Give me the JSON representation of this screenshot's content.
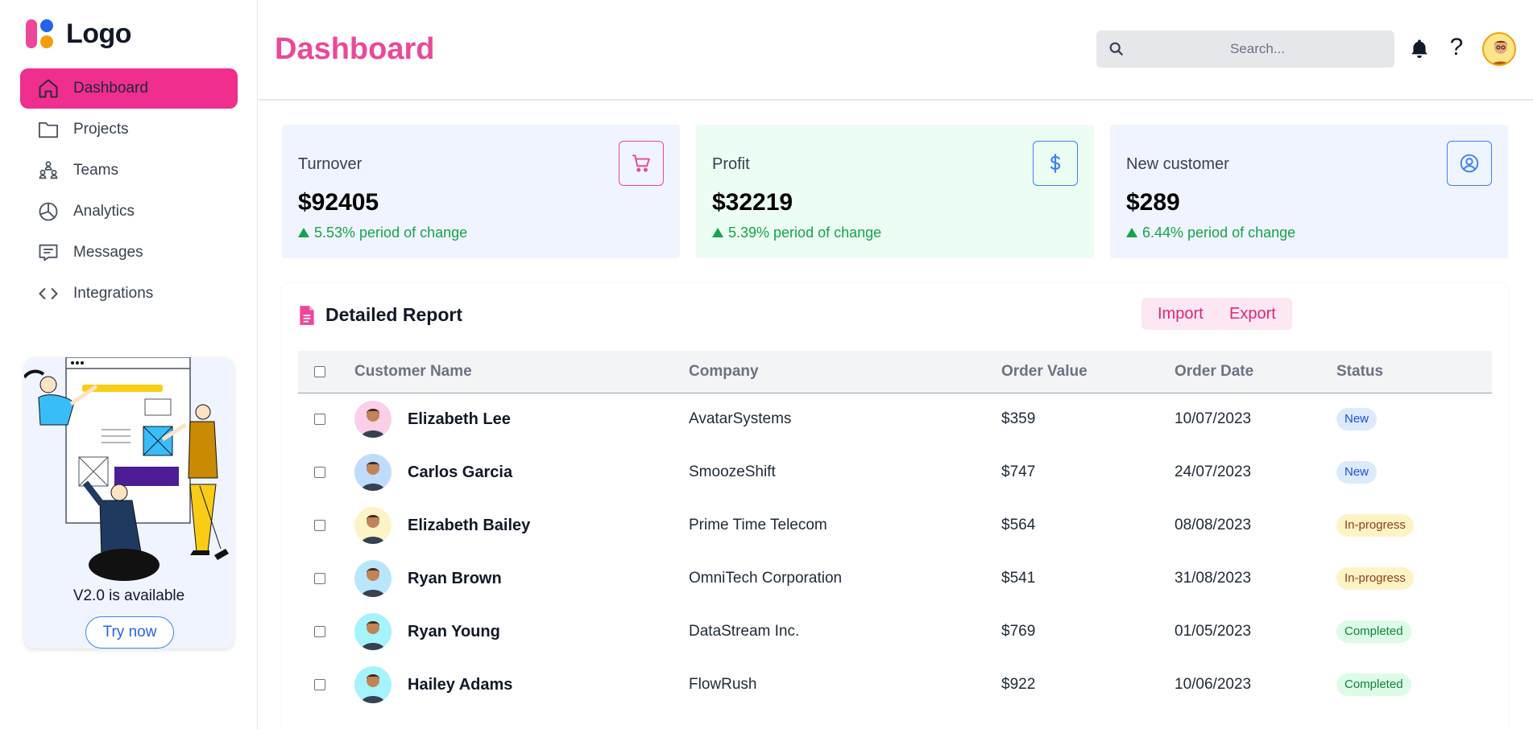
{
  "logo": {
    "text": "Logo"
  },
  "nav": {
    "items": [
      {
        "label": "Dashboard",
        "icon": "home-icon",
        "active": true
      },
      {
        "label": "Projects",
        "icon": "folder-icon"
      },
      {
        "label": "Teams",
        "icon": "teams-icon"
      },
      {
        "label": "Analytics",
        "icon": "pie-chart-icon"
      },
      {
        "label": "Messages",
        "icon": "message-icon"
      },
      {
        "label": "Integrations",
        "icon": "code-icon"
      }
    ]
  },
  "promo": {
    "title": "V2.0 is available",
    "button_label": "Try now"
  },
  "header": {
    "title": "Dashboard",
    "search_placeholder": "Search...",
    "help_label": "?"
  },
  "cards": [
    {
      "label": "Turnover",
      "value": "$92405",
      "change": "5.53% period of change",
      "icon": "cart-icon",
      "bg": "#eff4ff",
      "icon_color": "#ec4899"
    },
    {
      "label": "Profit",
      "value": "$32219",
      "change": "5.39% period of change",
      "icon": "dollar-icon",
      "bg": "#ecfdf3",
      "icon_color": "#3b82f6"
    },
    {
      "label": "New customer",
      "value": "$289",
      "change": "6.44% period of change",
      "icon": "user-circle-icon",
      "bg": "#eff4ff",
      "icon_color": "#3b82f6"
    }
  ],
  "report": {
    "title": "Detailed Report",
    "import_label": "Import",
    "export_label": "Export",
    "columns": [
      "Customer Name",
      "Company",
      "Order Value",
      "Order Date",
      "Status"
    ],
    "rows": [
      {
        "name": "Elizabeth Lee",
        "company": "AvatarSystems",
        "value": "$359",
        "date": "10/07/2023",
        "status": "New",
        "status_kind": "new",
        "avatar_bg": "#fbcfe8"
      },
      {
        "name": "Carlos Garcia",
        "company": "SmoozeShift",
        "value": "$747",
        "date": "24/07/2023",
        "status": "New",
        "status_kind": "new",
        "avatar_bg": "#bfdbfe"
      },
      {
        "name": "Elizabeth Bailey",
        "company": "Prime Time Telecom",
        "value": "$564",
        "date": "08/08/2023",
        "status": "In-progress",
        "status_kind": "inprogress",
        "avatar_bg": "#fef3c7"
      },
      {
        "name": "Ryan Brown",
        "company": "OmniTech Corporation",
        "value": "$541",
        "date": "31/08/2023",
        "status": "In-progress",
        "status_kind": "inprogress",
        "avatar_bg": "#bae6fd"
      },
      {
        "name": "Ryan Young",
        "company": "DataStream Inc.",
        "value": "$769",
        "date": "01/05/2023",
        "status": "Completed",
        "status_kind": "completed",
        "avatar_bg": "#a5f3fc"
      },
      {
        "name": "Hailey Adams",
        "company": "FlowRush",
        "value": "$922",
        "date": "10/06/2023",
        "status": "Completed",
        "status_kind": "completed",
        "avatar_bg": "#a5f3fc"
      }
    ]
  }
}
